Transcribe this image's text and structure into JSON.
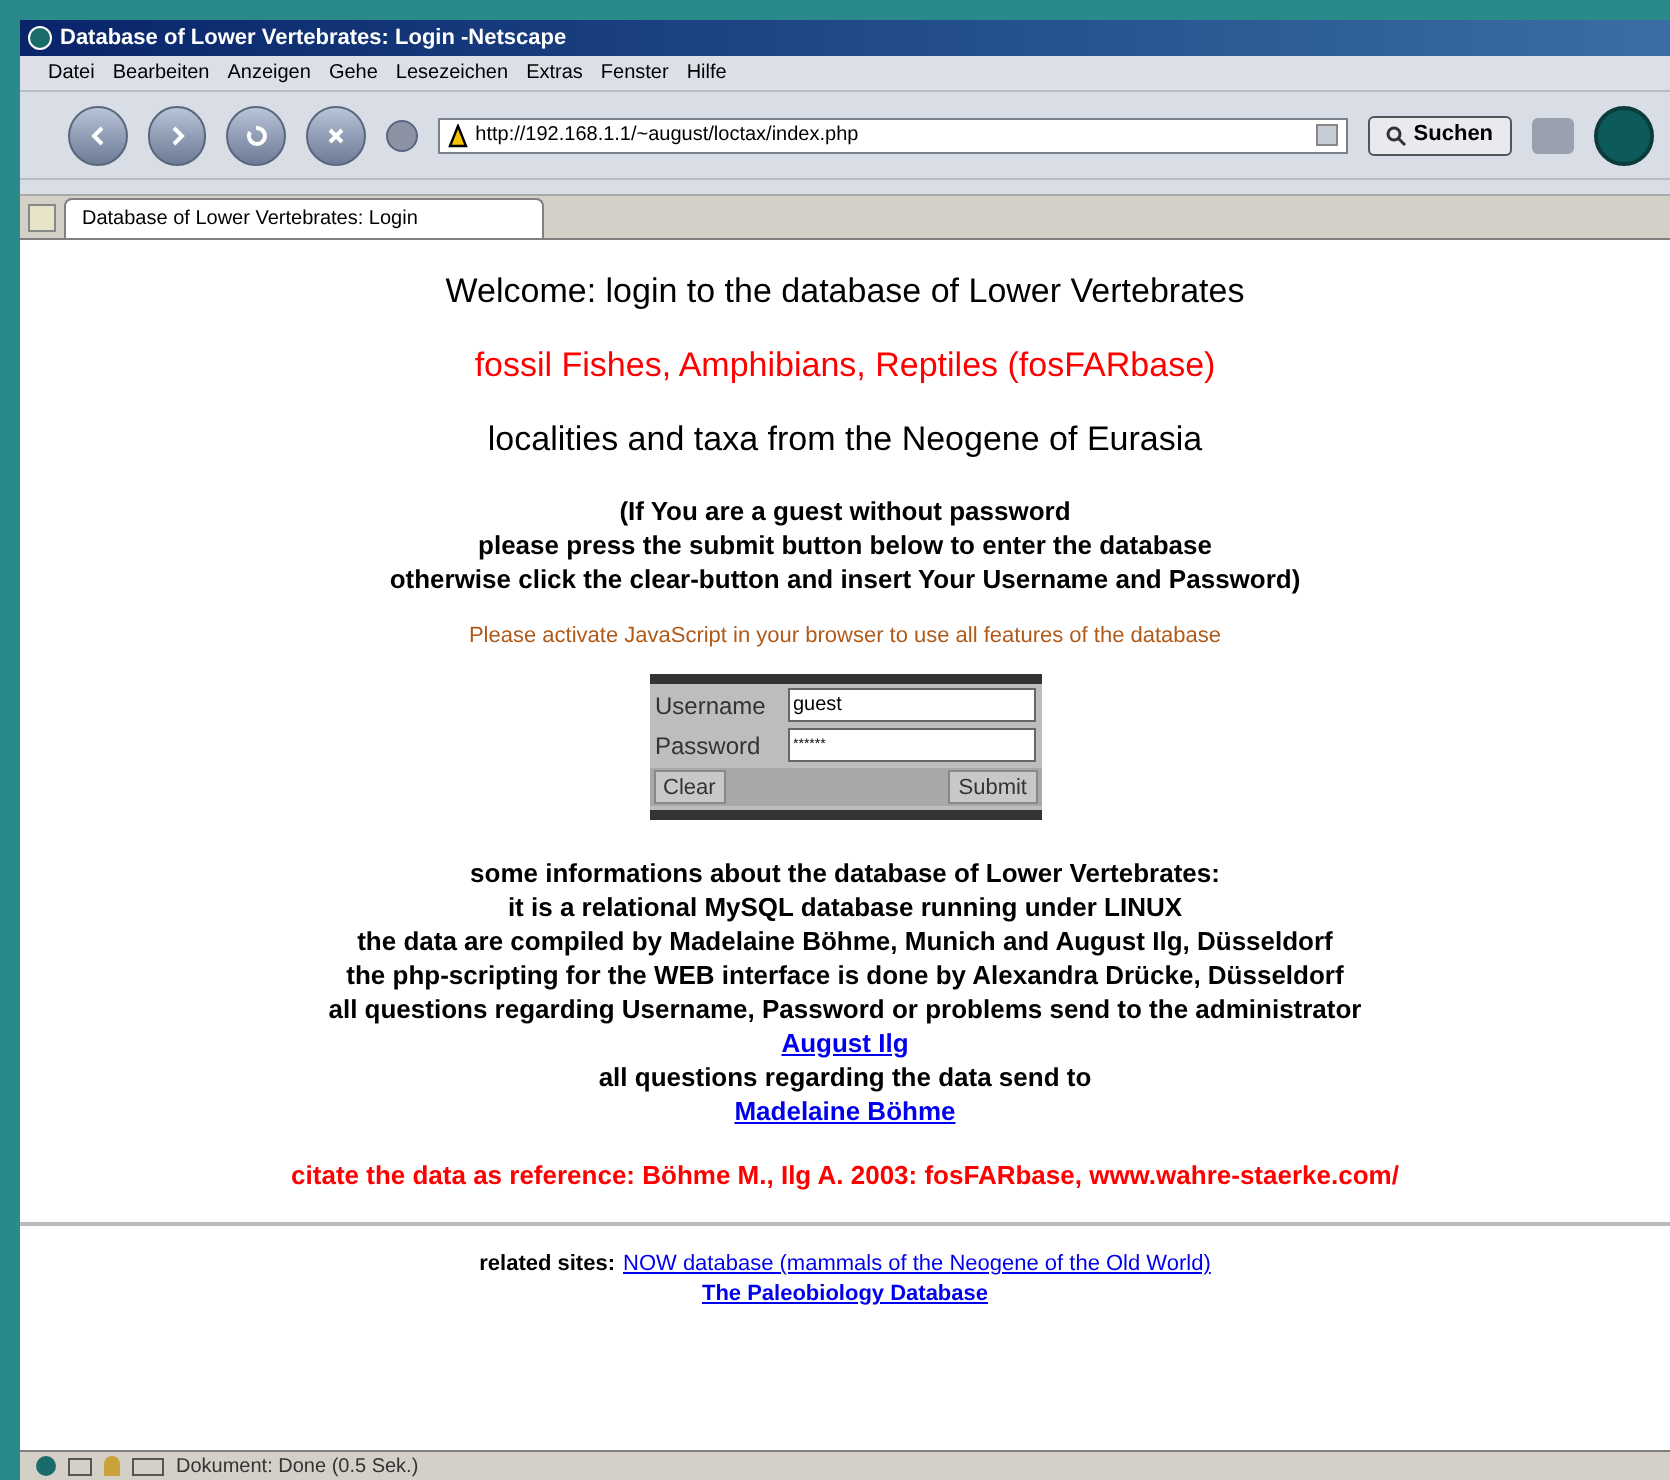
{
  "window": {
    "title": "Database of Lower Vertebrates: Login -Netscape"
  },
  "menu": [
    "Datei",
    "Bearbeiten",
    "Anzeigen",
    "Gehe",
    "Lesezeichen",
    "Extras",
    "Fenster",
    "Hilfe"
  ],
  "toolbar": {
    "url": "http://192.168.1.1/~august/loctax/index.php",
    "search_button": "Suchen"
  },
  "tabs": [
    {
      "label": "Database of Lower Vertebrates: Login",
      "selected": true
    }
  ],
  "page": {
    "headings": [
      {
        "text": "Welcome: login to the database of Lower Vertebrates",
        "kind": "black"
      },
      {
        "text": "fossil Fishes, Amphibians, Reptiles (fosFARbase)",
        "kind": "red"
      },
      {
        "text": "localities and taxa from the Neogene of Eurasia",
        "kind": "black"
      }
    ],
    "guest_note": [
      "(If You are a guest without password",
      "please press the submit button below to enter the database",
      "otherwise click the clear-button and insert Your Username and Password)"
    ],
    "js_note": "Please activate JavaScript in your browser to use all features of the database",
    "login": {
      "username_label": "Username",
      "username": "guest",
      "password_label": "Password",
      "password": "******",
      "clear": "Clear",
      "submit": "Submit"
    },
    "info": [
      {
        "kind": "text",
        "text": "some informations about the database of Lower Vertebrates:"
      },
      {
        "kind": "text",
        "text": "it is a relational MySQL database running under LINUX"
      },
      {
        "kind": "text",
        "text": "the data are compiled by Madelaine Böhme, Munich and August Ilg, Düsseldorf"
      },
      {
        "kind": "text",
        "text": "the php-scripting for the WEB interface is done by Alexandra Drücke, Düsseldorf"
      },
      {
        "kind": "text",
        "text": "all questions regarding Username, Password or problems send to the administrator"
      },
      {
        "kind": "link",
        "text": "August Ilg"
      },
      {
        "kind": "text",
        "text": "all questions regarding the data send to"
      },
      {
        "kind": "link",
        "text": "Madelaine Böhme"
      }
    ],
    "citation": "citate the data as reference: Böhme M., Ilg A. 2003: fosFARbase, www.wahre-staerke.com/",
    "related_label": "related sites:",
    "related_links": [
      "NOW database (mammals of the Neogene of the Old World)",
      "The Paleobiology Database"
    ]
  },
  "status_bar": {
    "text": "Dokument: Done (0.5 Sek.)"
  }
}
